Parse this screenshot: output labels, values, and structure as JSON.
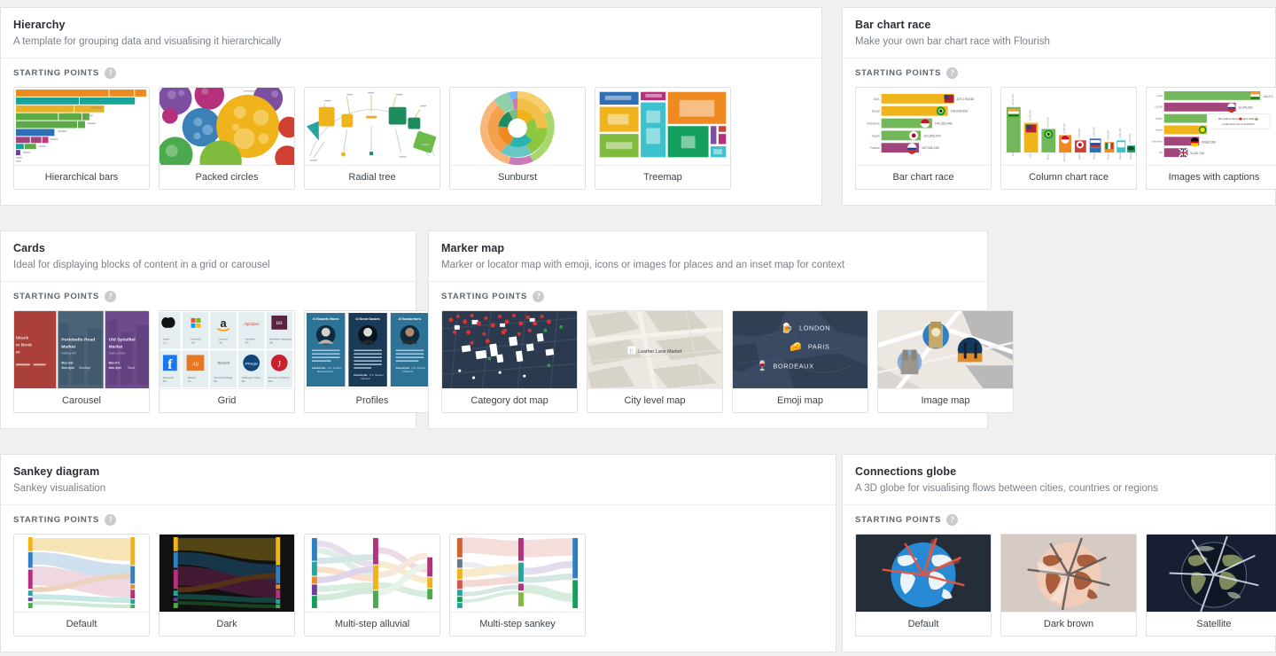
{
  "ui": {
    "starting_points_label": "STARTING POINTS",
    "help_icon_glyph": "?",
    "help_icon_name": "help-circle-icon",
    "background": "#f0f0f0",
    "card_border": "#e0e0e0",
    "title_color": "#2b2f33",
    "subtitle_color": "#7b8187"
  },
  "panels": [
    {
      "id": "hierarchy",
      "title": "Hierarchy",
      "subtitle": "A template for grouping data and visualising it hierarchically",
      "templates": [
        {
          "id": "hierarchical-bars",
          "label": "Hierarchical bars"
        },
        {
          "id": "packed-circles",
          "label": "Packed circles"
        },
        {
          "id": "radial-tree",
          "label": "Radial tree"
        },
        {
          "id": "sunburst",
          "label": "Sunburst"
        },
        {
          "id": "treemap",
          "label": "Treemap"
        }
      ]
    },
    {
      "id": "bar-chart-race",
      "title": "Bar chart race",
      "subtitle": "Make your own bar chart race with Flourish",
      "templates": [
        {
          "id": "bar-chart-race",
          "label": "Bar chart race"
        },
        {
          "id": "column-chart-race",
          "label": "Column chart race"
        },
        {
          "id": "images-with-captions",
          "label": "Images with captions"
        }
      ]
    },
    {
      "id": "cards",
      "title": "Cards",
      "subtitle": "Ideal for displaying blocks of content in a grid or carousel",
      "templates": [
        {
          "id": "carousel",
          "label": "Carousel"
        },
        {
          "id": "grid",
          "label": "Grid"
        },
        {
          "id": "profiles",
          "label": "Profiles"
        }
      ]
    },
    {
      "id": "marker-map",
      "title": "Marker map",
      "subtitle": "Marker or locator map with emoji, icons or images for places and an inset map for context",
      "templates": [
        {
          "id": "category-dot-map",
          "label": "Category dot map"
        },
        {
          "id": "city-level-map",
          "label": "City level map"
        },
        {
          "id": "emoji-map",
          "label": "Emoji map"
        },
        {
          "id": "image-map",
          "label": "Image map"
        }
      ]
    },
    {
      "id": "sankey-diagram",
      "title": "Sankey diagram",
      "subtitle": "Sankey visualisation",
      "templates": [
        {
          "id": "default",
          "label": "Default"
        },
        {
          "id": "dark",
          "label": "Dark"
        },
        {
          "id": "multi-step-alluvial",
          "label": "Multi-step alluvial"
        },
        {
          "id": "multi-step-sankey",
          "label": "Multi-step sankey"
        }
      ]
    },
    {
      "id": "connections-globe",
      "title": "Connections globe",
      "subtitle": "A 3D globe for visualising flows between cities, countries or regions",
      "templates": [
        {
          "id": "default",
          "label": "Default"
        },
        {
          "id": "dark-brown",
          "label": "Dark brown"
        },
        {
          "id": "satellite",
          "label": "Satellite"
        }
      ]
    }
  ],
  "thumbnails": {
    "bar_chart_race": {
      "rows": [
        {
          "name": "USA",
          "value": "207,278,040",
          "color": "#f0a829",
          "width": 78,
          "flag": "usa"
        },
        {
          "name": "Brazil",
          "value": "190,004,620",
          "color": "#f0a829",
          "width": 68,
          "flag": "brazil"
        },
        {
          "name": "Indonesia",
          "value": "144,253,448",
          "color": "#72b85a",
          "width": 53,
          "flag": "indonesia"
        },
        {
          "name": "Japan",
          "value": "110,053,379",
          "color": "#72b85a",
          "width": 43,
          "flag": "japan"
        },
        {
          "name": "Russia",
          "value": "107,340,253",
          "color": "#a3457c",
          "width": 41,
          "flag": "russia"
        }
      ]
    },
    "images_with_captions": {
      "rows": [
        {
          "name": "India",
          "value": "143,271,",
          "color": "#72b85a",
          "width": 92,
          "flag": "india"
        },
        {
          "name": "USSR",
          "value": "92,470,000",
          "color": "#a3457c",
          "width": 68,
          "flag": "russia"
        },
        {
          "name": "Japan",
          "value": "",
          "color": "#72b85a",
          "width": 44,
          "flag": "japan"
        },
        {
          "name": "Brazil",
          "value": "",
          "color": "#f0a829",
          "width": 40,
          "flag": "brazil"
        },
        {
          "name": "Germany",
          "value": "69,883,000",
          "color": "#a3457c",
          "width": 33,
          "flag": "germany"
        },
        {
          "name": "UK",
          "value": "51,611,728",
          "color": "#a3457c",
          "width": 22,
          "flag": "uk"
        }
      ],
      "tooltip": "But watch China 🇨🇳 and India 🇮🇳 rocket from the mid-1970s!"
    },
    "emoji_map": {
      "places": [
        {
          "label": "LONDON",
          "emoji": "🍺"
        },
        {
          "label": "PARIS",
          "emoji": "🧀"
        },
        {
          "label": "BORDEAUX",
          "emoji": "🍷"
        }
      ]
    },
    "city_level_map": {
      "marker_label": "Leather Lane Market",
      "marker_emoji": "🍴"
    },
    "carousel": {
      "cards": [
        {
          "title": "Broadback Film Book Market",
          "sub": "",
          "color": "#b5443c"
        },
        {
          "title": "Portobello Road Market",
          "sub": "Notting Hill",
          "color": "#4a6379"
        },
        {
          "title": "Old Spitalfields Market",
          "sub": "East London",
          "color": "#6f4b8e"
        }
      ]
    },
    "profiles": {
      "cards": [
        {
          "name": "Elizabeth Warren",
          "prefix": "65"
        },
        {
          "name": "Bernie Sanders",
          "prefix": "43"
        },
        {
          "name": "Kamala Harris",
          "prefix": "32"
        }
      ]
    },
    "grid": {
      "cells": [
        "Apple",
        "Microsoft",
        "Amazon",
        "Alphabet",
        "Berkshire Hathaway",
        "Facebook",
        "Alibaba",
        "Tencent Holdings",
        "JPMorgan Chase",
        "Johnson & Johnson"
      ]
    }
  }
}
